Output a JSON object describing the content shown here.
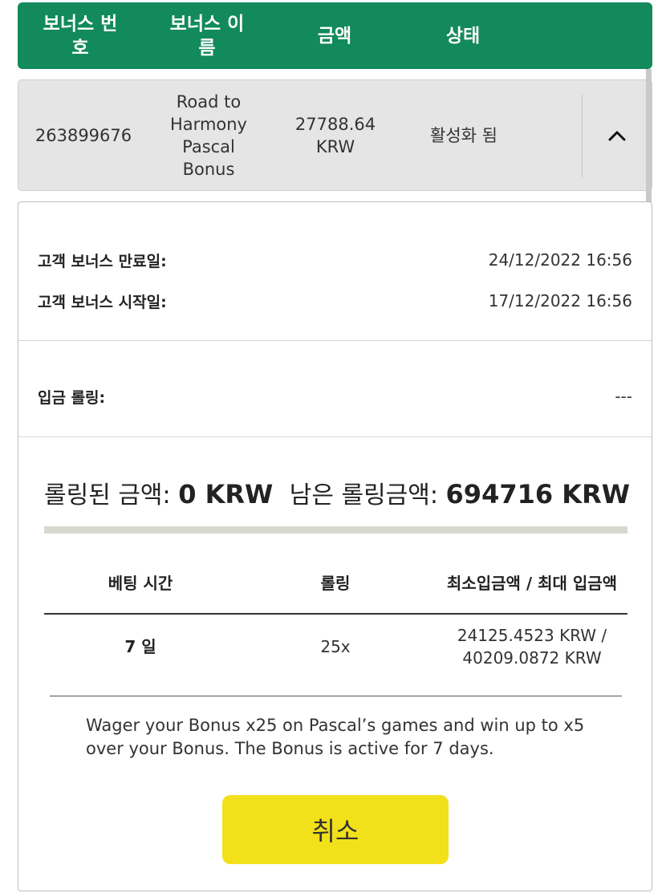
{
  "header": {
    "col_bonus_number": "보너스 번호",
    "col_bonus_name": "보너스 이름",
    "col_amount": "금액",
    "col_status": "상태"
  },
  "bonus_row": {
    "number": "263899676",
    "name": "Road to Harmony Pascal Bonus",
    "amount": "27788.64 KRW",
    "status": "활성화 됨",
    "expand_icon": "chevron-up-icon"
  },
  "details": {
    "expiry_label": "고객 보너스 만료일:",
    "expiry_value": "24/12/2022 16:56",
    "start_label": "고객 보너스 시작일:",
    "start_value": "17/12/2022 16:56",
    "deposit_rolling_label": "입금 롤링:",
    "deposit_rolling_value": "---"
  },
  "rolling": {
    "rolled_label": "롤링된 금액:",
    "rolled_value": "0 KRW",
    "remaining_label": "남은 롤링금액:",
    "remaining_value": "694716 KRW",
    "progress_fraction": 0
  },
  "terms_table": {
    "headers": [
      "베팅 시간",
      "롤링",
      "최소입금액 / 최대 입금액"
    ],
    "row": [
      "7 일",
      "25x",
      "24125.4523 KRW / 40209.0872 KRW"
    ]
  },
  "description": "Wager your Bonus x25 on Pascal’s games and win up to x5 over your Bonus. The Bonus is active for 7 days.",
  "cancel_button": "취소"
}
